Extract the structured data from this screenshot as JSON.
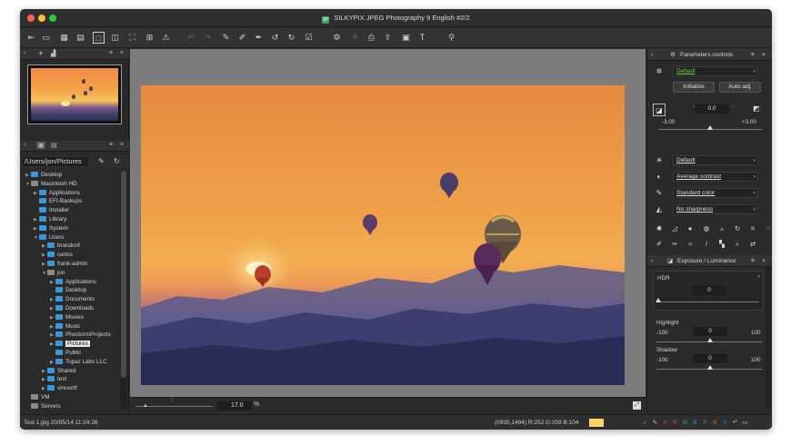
{
  "window": {
    "title": "SILKYPIX JPEG Photography 9 English  #2/2",
    "app_icon_text": "SP"
  },
  "toolbar": {
    "buttons": [
      {
        "name": "toolbar-back-icon",
        "glyph": "⇤",
        "active": false,
        "dim": false
      },
      {
        "name": "toolbar-comment-icon",
        "glyph": "▭",
        "active": false,
        "dim": false
      },
      {
        "name": "toolbar-grid-view-icon",
        "glyph": "▦",
        "active": false,
        "dim": false
      },
      {
        "name": "toolbar-filmstrip-icon",
        "glyph": "▤",
        "active": false,
        "dim": false
      },
      {
        "name": "toolbar-single-view-icon",
        "glyph": "□",
        "active": true,
        "dim": false
      },
      {
        "name": "toolbar-compare-icon",
        "glyph": "◫",
        "active": false,
        "dim": false
      },
      {
        "name": "toolbar-fullscreen-icon",
        "glyph": "⛶",
        "active": false,
        "dim": false
      },
      {
        "name": "toolbar-grid-overlay-icon",
        "glyph": "⊞",
        "active": false,
        "dim": false
      },
      {
        "name": "toolbar-warning-icon",
        "glyph": "⚠",
        "active": false,
        "dim": false
      },
      {
        "name": "toolbar-undo-icon",
        "glyph": "↶",
        "active": false,
        "dim": true
      },
      {
        "name": "toolbar-redo-icon",
        "glyph": "↷",
        "active": false,
        "dim": true
      },
      {
        "name": "toolbar-copy-param-icon",
        "glyph": "✎",
        "active": false,
        "dim": false
      },
      {
        "name": "toolbar-paste-param-icon",
        "glyph": "✐",
        "active": false,
        "dim": false
      },
      {
        "name": "toolbar-brush-icon",
        "glyph": "✒",
        "active": false,
        "dim": false
      },
      {
        "name": "toolbar-rotate-left-icon",
        "glyph": "↺",
        "active": false,
        "dim": false
      },
      {
        "name": "toolbar-rotate-right-icon",
        "glyph": "↻",
        "active": false,
        "dim": false
      },
      {
        "name": "toolbar-check-icon",
        "glyph": "☑",
        "active": false,
        "dim": false
      },
      {
        "name": "toolbar-develop-icon",
        "glyph": "⚙",
        "active": false,
        "dim": false
      },
      {
        "name": "toolbar-batch-develop-icon",
        "glyph": "⚘",
        "active": false,
        "dim": true
      },
      {
        "name": "toolbar-print-icon",
        "glyph": "⎙",
        "active": false,
        "dim": false
      },
      {
        "name": "toolbar-export-icon",
        "glyph": "⇪",
        "active": false,
        "dim": false
      },
      {
        "name": "toolbar-display-icon",
        "glyph": "▣",
        "active": false,
        "dim": false
      },
      {
        "name": "toolbar-text-icon",
        "glyph": "T",
        "active": false,
        "dim": false
      },
      {
        "name": "toolbar-search-icon",
        "glyph": "⚲",
        "active": false,
        "dim": false
      }
    ]
  },
  "left": {
    "path": "/Users/jon/Pictures",
    "tree": [
      {
        "label": "Desktop",
        "depth": 0,
        "arrow": "▶",
        "type": "folder"
      },
      {
        "label": "Macintosh HD",
        "depth": 0,
        "arrow": "▼",
        "type": "disk"
      },
      {
        "label": "Applications",
        "depth": 1,
        "arrow": "▶",
        "type": "folder"
      },
      {
        "label": "EFI-Backups",
        "depth": 1,
        "arrow": "",
        "type": "folder"
      },
      {
        "label": "Installer",
        "depth": 1,
        "arrow": "",
        "type": "folder"
      },
      {
        "label": "Library",
        "depth": 1,
        "arrow": "▶",
        "type": "folder"
      },
      {
        "label": "System",
        "depth": 1,
        "arrow": "▶",
        "type": "folder"
      },
      {
        "label": "Users",
        "depth": 1,
        "arrow": "▼",
        "type": "folder"
      },
      {
        "label": "brandonf",
        "depth": 2,
        "arrow": "▶",
        "type": "folder"
      },
      {
        "label": "carlos",
        "depth": 2,
        "arrow": "▶",
        "type": "folder"
      },
      {
        "label": "frank-admin",
        "depth": 2,
        "arrow": "▶",
        "type": "folder"
      },
      {
        "label": "jon",
        "depth": 2,
        "arrow": "▼",
        "type": "disk"
      },
      {
        "label": "Applications",
        "depth": 3,
        "arrow": "▶",
        "type": "folder"
      },
      {
        "label": "Desktop",
        "depth": 3,
        "arrow": "",
        "type": "folder"
      },
      {
        "label": "Documents",
        "depth": 3,
        "arrow": "▶",
        "type": "folder"
      },
      {
        "label": "Downloads",
        "depth": 3,
        "arrow": "▶",
        "type": "folder"
      },
      {
        "label": "Movies",
        "depth": 3,
        "arrow": "▶",
        "type": "folder"
      },
      {
        "label": "Music",
        "depth": 3,
        "arrow": "▶",
        "type": "folder"
      },
      {
        "label": "PhostormProjects",
        "depth": 3,
        "arrow": "▶",
        "type": "folder"
      },
      {
        "label": "Pictures",
        "depth": 3,
        "arrow": "▶",
        "type": "folder",
        "selected": true
      },
      {
        "label": "Public",
        "depth": 3,
        "arrow": "",
        "type": "folder"
      },
      {
        "label": "Topaz Labs LLC",
        "depth": 3,
        "arrow": "▶",
        "type": "folder"
      },
      {
        "label": "Shared",
        "depth": 2,
        "arrow": "▶",
        "type": "folder"
      },
      {
        "label": "test",
        "depth": 2,
        "arrow": "▶",
        "type": "folder"
      },
      {
        "label": "vincentf",
        "depth": 2,
        "arrow": "▶",
        "type": "folder"
      },
      {
        "label": "VM",
        "depth": 0,
        "arrow": "",
        "type": "disk"
      },
      {
        "label": "Servers",
        "depth": 0,
        "arrow": "",
        "type": "disk"
      }
    ]
  },
  "center": {
    "zoom_value": "17.0",
    "zoom_unit": "%"
  },
  "right": {
    "header_title": "Parameters controls",
    "taste": "Default",
    "initialize_label": "Initialize",
    "auto_adj_label": "Auto adj.",
    "exposure_value": "0.0",
    "exposure_min": "-3.00",
    "exposure_max": "+3.00",
    "white_balance": "Default",
    "tone": "Average contrast",
    "color": "Standard color",
    "sharpness": "No sharpness",
    "section_title": "Exposure / Luminance",
    "hdr": {
      "label": "HDR",
      "value": "0"
    },
    "highlight": {
      "label": "Highlight",
      "value": "0",
      "min": "-100",
      "max": "100"
    },
    "shadow": {
      "label": "Shadow",
      "value": "0",
      "min": "-100",
      "max": "100"
    }
  },
  "status": {
    "file_info": "Test 1.jpg 20/05/14 11:24:26",
    "pixel_info": "(0935,1494) R:252 G:209 B:104",
    "swatch_color": "#fcd168",
    "right_icons": [
      {
        "name": "status-check-icon",
        "glyph": "✓",
        "color": "#7fbf3f"
      },
      {
        "name": "status-tag-icon",
        "glyph": "✎",
        "color": "#c0c0c0"
      },
      {
        "name": "status-reject-icon",
        "glyph": "✕",
        "color": "#d04040"
      },
      {
        "name": "status-color-r-icon",
        "glyph": "R",
        "color": "#e04040"
      },
      {
        "name": "status-color-g-icon",
        "glyph": "G",
        "color": "#40c040"
      },
      {
        "name": "status-color-b-icon",
        "glyph": "B",
        "color": "#4080e0"
      },
      {
        "name": "status-color-p-icon",
        "glyph": "P",
        "color": "#c040c0"
      },
      {
        "name": "status-color-r2-icon",
        "glyph": "R",
        "color": "#f06030"
      },
      {
        "name": "status-color-b2-icon",
        "glyph": "B",
        "color": "#3060d0"
      },
      {
        "name": "status-undo-icon",
        "glyph": "↶",
        "color": "#c0c0c0"
      },
      {
        "name": "status-settings-icon",
        "glyph": "▭",
        "color": "#c0c0c0"
      }
    ]
  }
}
